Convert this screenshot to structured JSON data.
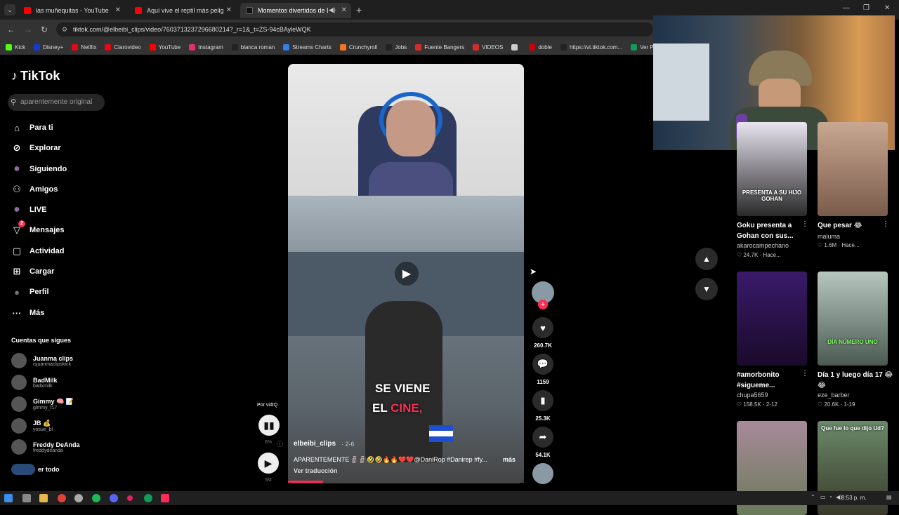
{
  "browser": {
    "tabs": [
      {
        "title": "las muñequitas - YouTube",
        "color": "#ff0000"
      },
      {
        "title": "Aquí vive el reptil más peligros",
        "color": "#ff0000"
      },
      {
        "title": "Momentos divertidos de Da",
        "color": "#111111",
        "active": true
      }
    ],
    "new_tab": "+",
    "url": "tiktok.com/@elbeibi_clips/video/7603713237296680214?_r=1&_t=ZS-94cBAyleWQK",
    "bookmarks": [
      "Kick",
      "Disney+",
      "Netflix",
      "Clarovideo",
      "YouTube",
      "Instagram",
      "blanca roman",
      "Streams Charts",
      "Crunchyroll",
      "Jobs",
      "Fuente Bangers",
      "VIDEOS",
      "",
      "doble",
      "https://vt.tiktok.com...",
      "Ver Pa"
    ],
    "bookmark_colors": [
      "#53fc18",
      "#113ccf",
      "#e50914",
      "#e50914",
      "#ff0000",
      "#e1306c",
      "#222222",
      "#2f80ed",
      "#f47521",
      "#222222",
      "#d62b2b",
      "#d62b2b",
      "#cccccc",
      "#cc0000",
      "#222222",
      "#0f9d58"
    ]
  },
  "sidebar": {
    "logo": "TikTok",
    "search_placeholder": "aparentemente original",
    "nav": [
      {
        "label": "Para ti",
        "icon": "home-icon",
        "glyph": "⌂"
      },
      {
        "label": "Explorar",
        "icon": "compass-icon",
        "glyph": "⊘"
      },
      {
        "label": "Siguiendo",
        "icon": "following-avatar-icon",
        "glyph": "●"
      },
      {
        "label": "Amigos",
        "icon": "friends-icon",
        "glyph": "⚇"
      },
      {
        "label": "LIVE",
        "icon": "live-avatar-icon",
        "glyph": "●"
      },
      {
        "label": "Mensajes",
        "icon": "messages-icon",
        "glyph": "▽",
        "badge": "2"
      },
      {
        "label": "Actividad",
        "icon": "activity-icon",
        "glyph": "▢"
      },
      {
        "label": "Cargar",
        "icon": "upload-icon",
        "glyph": "⊞"
      },
      {
        "label": "Perfil",
        "icon": "profile-icon",
        "glyph": "●"
      },
      {
        "label": "Más",
        "icon": "more-icon",
        "glyph": "···"
      }
    ],
    "following_heading": "Cuentas que sigues",
    "following": [
      {
        "name": "Juanma clips",
        "handle": "isjuanmaclipskick"
      },
      {
        "name": "BadMilk",
        "handle": "badxmilk"
      },
      {
        "name": "Gimmy 🧠 📝",
        "handle": "gimmy_f17"
      },
      {
        "name": "JB 💰",
        "handle": "yosue_bl"
      },
      {
        "name": "Freddy DeAnda",
        "handle": "freddydeanda"
      }
    ],
    "see_all": "er todo"
  },
  "video": {
    "caption_line1": "SE VIENE",
    "caption_line2a": "EL ",
    "caption_line2b": "CINE,",
    "author": "elbeibi_clips",
    "date": "· 2-6",
    "description": "APARENTEMENTE 🗿🗿🤣🤣🔥🔥❤️❤️@DaniRop #Danirep #fy...",
    "more": "más",
    "translate": "Ver traducción",
    "progress": 0.15
  },
  "left_controls": {
    "por_label": "Por vidIQ",
    "percent": "6%",
    "views": "5M"
  },
  "actions": {
    "likes": "260.7K",
    "comments": "1159",
    "saves": "25.3K",
    "shares": "54.1K"
  },
  "related": [
    {
      "title": "Goku presenta a Gohan con sus...",
      "user": "akarocampechano",
      "likes": "24.7K",
      "when": "Hace...",
      "thumb_text": "PRESENTA A SU HIJO GOHAN",
      "colors": [
        "#e8e4f0",
        "#2a2a2a"
      ]
    },
    {
      "title": "Que pesar 😂",
      "user": "maluma",
      "likes": "1.6M",
      "when": "Hace...",
      "thumb_text": "",
      "colors": [
        "#c9a892",
        "#7a5a4a"
      ]
    },
    {
      "title": "#amorbonito #sigueme...",
      "user": "chupa5659",
      "likes": "158.5K",
      "when": "2-12",
      "thumb_text": "",
      "colors": [
        "#3a1a6a",
        "#1a0a2a"
      ]
    },
    {
      "title": "Día 1 y luego día 17 😂😂",
      "user": "eze_barber",
      "likes": "20.6K",
      "when": "1-19",
      "thumb_text": "DÍA NÚMERO UNO",
      "colors": [
        "#b8c6c0",
        "#4a5a52"
      ]
    },
    {
      "title": "",
      "user": "",
      "likes": "",
      "when": "",
      "thumb_text": "",
      "colors": [
        "#a88a9a",
        "#6a7a5a"
      ]
    },
    {
      "title": "",
      "user": "",
      "likes": "",
      "when": "",
      "thumb_text": "Que fue lo que dijo Ud?",
      "colors": [
        "#6a8a6a",
        "#3a3a2a"
      ]
    }
  ],
  "taskbar": {
    "clock": "8:53 p. m."
  },
  "colors": {
    "accent": "#fe2c55",
    "background": "#000000",
    "panel": "#262626"
  }
}
